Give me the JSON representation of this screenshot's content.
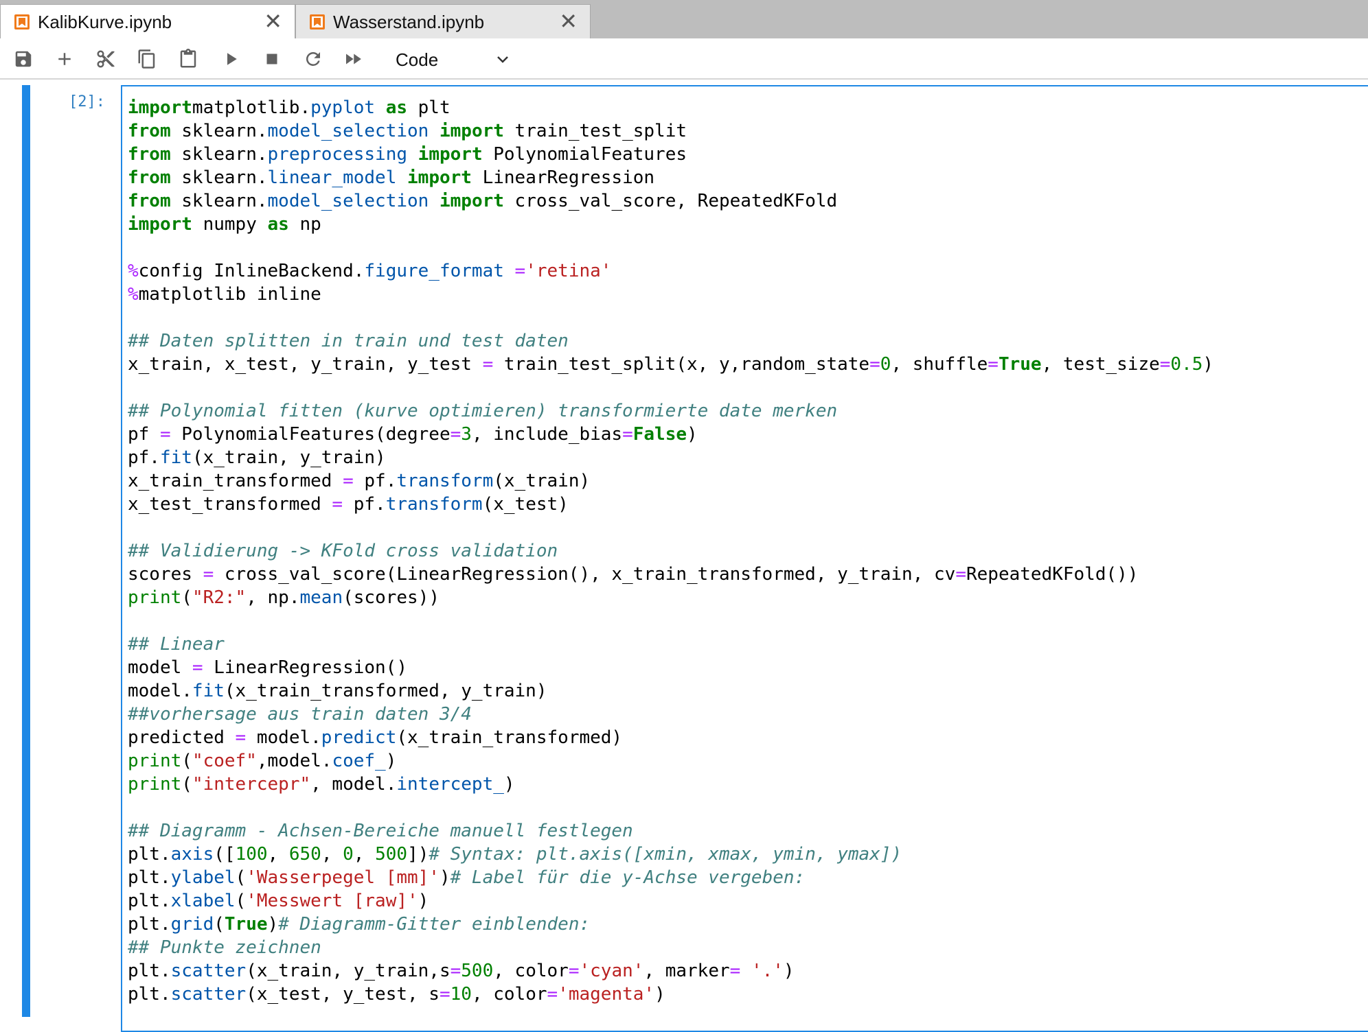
{
  "tabs": [
    {
      "label": "KalibKurve.ipynb",
      "active": true
    },
    {
      "label": "Wasserstand.ipynb",
      "active": false
    }
  ],
  "toolbar": {
    "cell_type": "Code",
    "buttons": [
      "save-icon",
      "plus-icon",
      "scissors-icon",
      "copy-icon",
      "paste-icon",
      "run-icon",
      "stop-icon",
      "restart-icon",
      "fast-forward-icon"
    ]
  },
  "cell": {
    "prompt": "[2]:",
    "lines": [
      [
        [
          "kw",
          "import"
        ],
        [
          "",
          "matplotlib."
        ],
        [
          "attr",
          "pyplot"
        ],
        [
          "",
          " "
        ],
        [
          "kw",
          "as"
        ],
        [
          "",
          " plt"
        ]
      ],
      [
        [
          "kw",
          "from"
        ],
        [
          "",
          " sklearn."
        ],
        [
          "attr",
          "model_selection"
        ],
        [
          "",
          " "
        ],
        [
          "kw",
          "import"
        ],
        [
          "",
          " train_test_split"
        ]
      ],
      [
        [
          "kw",
          "from"
        ],
        [
          "",
          " sklearn."
        ],
        [
          "attr",
          "preprocessing"
        ],
        [
          "",
          " "
        ],
        [
          "kw",
          "import"
        ],
        [
          "",
          " PolynomialFeatures"
        ]
      ],
      [
        [
          "kw",
          "from"
        ],
        [
          "",
          " sklearn."
        ],
        [
          "attr",
          "linear_model"
        ],
        [
          "",
          " "
        ],
        [
          "kw",
          "import"
        ],
        [
          "",
          " LinearRegression"
        ]
      ],
      [
        [
          "kw",
          "from"
        ],
        [
          "",
          " sklearn."
        ],
        [
          "attr",
          "model_selection"
        ],
        [
          "",
          " "
        ],
        [
          "kw",
          "import"
        ],
        [
          "",
          " cross_val_score, RepeatedKFold"
        ]
      ],
      [
        [
          "kw",
          "import"
        ],
        [
          "",
          " numpy "
        ],
        [
          "kw",
          "as"
        ],
        [
          "",
          " np"
        ]
      ],
      [],
      [
        [
          "op",
          "%"
        ],
        [
          "",
          "config InlineBackend."
        ],
        [
          "attr",
          "figure_format"
        ],
        [
          "",
          " "
        ],
        [
          "op",
          "="
        ],
        [
          "str",
          "'retina'"
        ]
      ],
      [
        [
          "op",
          "%"
        ],
        [
          "",
          "matplotlib inline"
        ]
      ],
      [],
      [
        [
          "cm",
          "## Daten splitten in train und test daten"
        ]
      ],
      [
        [
          "",
          "x_train, x_test, y_train, y_test "
        ],
        [
          "op",
          "="
        ],
        [
          "",
          " train_test_split(x, y,random_state"
        ],
        [
          "op",
          "="
        ],
        [
          "num",
          "0"
        ],
        [
          "",
          ", shuffle"
        ],
        [
          "op",
          "="
        ],
        [
          "kw",
          "True"
        ],
        [
          "",
          ", test_size"
        ],
        [
          "op",
          "="
        ],
        [
          "num",
          "0.5"
        ],
        [
          "",
          ")"
        ]
      ],
      [],
      [
        [
          "cm",
          "## Polynomial fitten (kurve optimieren) transformierte date merken"
        ]
      ],
      [
        [
          "",
          "pf "
        ],
        [
          "op",
          "="
        ],
        [
          "",
          " PolynomialFeatures(degree"
        ],
        [
          "op",
          "="
        ],
        [
          "num",
          "3"
        ],
        [
          "",
          ", include_bias"
        ],
        [
          "op",
          "="
        ],
        [
          "kw",
          "False"
        ],
        [
          "",
          ")"
        ]
      ],
      [
        [
          "",
          "pf."
        ],
        [
          "attr",
          "fit"
        ],
        [
          "",
          "(x_train, y_train)"
        ]
      ],
      [
        [
          "",
          "x_train_transformed "
        ],
        [
          "op",
          "="
        ],
        [
          "",
          " pf."
        ],
        [
          "attr",
          "transform"
        ],
        [
          "",
          "(x_train)"
        ]
      ],
      [
        [
          "",
          "x_test_transformed "
        ],
        [
          "op",
          "="
        ],
        [
          "",
          " pf."
        ],
        [
          "attr",
          "transform"
        ],
        [
          "",
          "(x_test)"
        ]
      ],
      [],
      [
        [
          "cm",
          "## Validierung -> KFold cross validation"
        ]
      ],
      [
        [
          "",
          "scores "
        ],
        [
          "op",
          "="
        ],
        [
          "",
          " cross_val_score(LinearRegression(), x_train_transformed, y_train, cv"
        ],
        [
          "op",
          "="
        ],
        [
          "",
          "RepeatedKFold())"
        ]
      ],
      [
        [
          "bi",
          "print"
        ],
        [
          "",
          "("
        ],
        [
          "str",
          "\"R2:\""
        ],
        [
          "",
          ", np."
        ],
        [
          "attr",
          "mean"
        ],
        [
          "",
          "(scores))"
        ]
      ],
      [],
      [
        [
          "cm",
          "## Linear"
        ]
      ],
      [
        [
          "",
          "model "
        ],
        [
          "op",
          "="
        ],
        [
          "",
          " LinearRegression()"
        ]
      ],
      [
        [
          "",
          "model."
        ],
        [
          "attr",
          "fit"
        ],
        [
          "",
          "(x_train_transformed, y_train)"
        ]
      ],
      [
        [
          "cm",
          "##vorhersage aus train daten 3/4"
        ]
      ],
      [
        [
          "",
          "predicted "
        ],
        [
          "op",
          "="
        ],
        [
          "",
          " model."
        ],
        [
          "attr",
          "predict"
        ],
        [
          "",
          "(x_train_transformed)"
        ]
      ],
      [
        [
          "bi",
          "print"
        ],
        [
          "",
          "("
        ],
        [
          "str",
          "\"coef\""
        ],
        [
          "",
          ",model."
        ],
        [
          "attr",
          "coef_"
        ],
        [
          "",
          ")"
        ]
      ],
      [
        [
          "bi",
          "print"
        ],
        [
          "",
          "("
        ],
        [
          "str",
          "\"intercepr\""
        ],
        [
          "",
          ", model."
        ],
        [
          "attr",
          "intercept_"
        ],
        [
          "",
          ")"
        ]
      ],
      [],
      [
        [
          "cm",
          "## Diagramm - Achsen-Bereiche manuell festlegen"
        ]
      ],
      [
        [
          "",
          "plt."
        ],
        [
          "attr",
          "axis"
        ],
        [
          "",
          "(["
        ],
        [
          "num",
          "100"
        ],
        [
          "",
          ", "
        ],
        [
          "num",
          "650"
        ],
        [
          "",
          ", "
        ],
        [
          "num",
          "0"
        ],
        [
          "",
          ", "
        ],
        [
          "num",
          "500"
        ],
        [
          "",
          "])"
        ],
        [
          "cm",
          "# Syntax: plt.axis([xmin, xmax, ymin, ymax])"
        ]
      ],
      [
        [
          "",
          "plt."
        ],
        [
          "attr",
          "ylabel"
        ],
        [
          "",
          "("
        ],
        [
          "str",
          "'Wasserpegel [mm]'"
        ],
        [
          "",
          ")"
        ],
        [
          "cm",
          "# Label für die y-Achse vergeben:"
        ]
      ],
      [
        [
          "",
          "plt."
        ],
        [
          "attr",
          "xlabel"
        ],
        [
          "",
          "("
        ],
        [
          "str",
          "'Messwert [raw]'"
        ],
        [
          "",
          ")"
        ]
      ],
      [
        [
          "",
          "plt."
        ],
        [
          "attr",
          "grid"
        ],
        [
          "",
          "("
        ],
        [
          "kw",
          "True"
        ],
        [
          "",
          ")"
        ],
        [
          "cm",
          "# Diagramm-Gitter einblenden:"
        ]
      ],
      [
        [
          "cm",
          "## Punkte zeichnen"
        ]
      ],
      [
        [
          "",
          "plt."
        ],
        [
          "attr",
          "scatter"
        ],
        [
          "",
          "(x_train, y_train,s"
        ],
        [
          "op",
          "="
        ],
        [
          "num",
          "500"
        ],
        [
          "",
          ", color"
        ],
        [
          "op",
          "="
        ],
        [
          "str",
          "'cyan'"
        ],
        [
          "",
          ", marker"
        ],
        [
          "op",
          "="
        ],
        [
          "",
          " "
        ],
        [
          "str",
          "'.'"
        ],
        [
          "",
          ")"
        ]
      ],
      [
        [
          "",
          "plt."
        ],
        [
          "attr",
          "scatter"
        ],
        [
          "",
          "(x_test, y_test, s"
        ],
        [
          "op",
          "="
        ],
        [
          "num",
          "10"
        ],
        [
          "",
          ", color"
        ],
        [
          "op",
          "="
        ],
        [
          "str",
          "'magenta'"
        ],
        [
          "",
          ")"
        ]
      ]
    ]
  }
}
